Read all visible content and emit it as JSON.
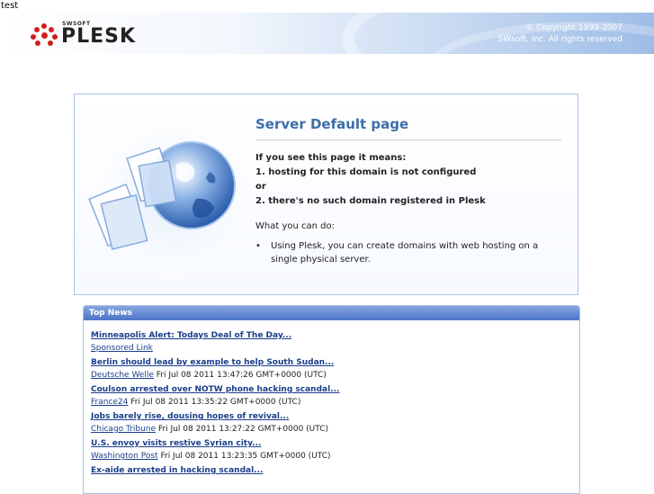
{
  "top_text": "test",
  "header": {
    "logo": {
      "brand_small": "SWSOFT",
      "brand": "PLESK"
    },
    "copyright_line1": "© Copyright 1999-2007",
    "copyright_line2": "SWsoft, Inc. All rights reserved"
  },
  "main": {
    "title": "Server Default page",
    "meaning_lines": [
      "If you see this page it means:",
      "1. hosting for this domain is not configured",
      "or",
      "2. there's no such domain registered in Plesk"
    ],
    "what_label": "What you can do:",
    "bullets": [
      "Using Plesk, you can create domains with web hosting on a single physical server."
    ]
  },
  "news": {
    "heading": "Top News",
    "items": [
      {
        "title": "Minneapolis Alert: Todays Deal of The Day...",
        "source": "Sponsored Link",
        "time": ""
      },
      {
        "title": "Berlin should lead by example to help South Sudan...",
        "source": "Deutsche Welle",
        "time": "Fri Jul 08 2011 13:47:26 GMT+0000 (UTC)"
      },
      {
        "title": "Coulson arrested over NOTW phone hacking scandal...",
        "source": "France24",
        "time": "Fri Jul 08 2011 13:35:22 GMT+0000 (UTC)"
      },
      {
        "title": "Jobs barely rise, dousing hopes of revival...",
        "source": "Chicago Tribune",
        "time": "Fri Jul 08 2011 13:27:22 GMT+0000 (UTC)"
      },
      {
        "title": "U.S. envoy visits restive Syrian city...",
        "source": "Washington Post",
        "time": "Fri Jul 08 2011 13:23:35 GMT+0000 (UTC)"
      },
      {
        "title": "Ex-aide arrested in hacking scandal...",
        "source": "",
        "time": ""
      }
    ]
  },
  "colors": {
    "title_blue": "#3d6ea8",
    "link_blue": "#1a3e8a",
    "logo_red": "#d21e1e",
    "news_header": "#5b80cc"
  }
}
